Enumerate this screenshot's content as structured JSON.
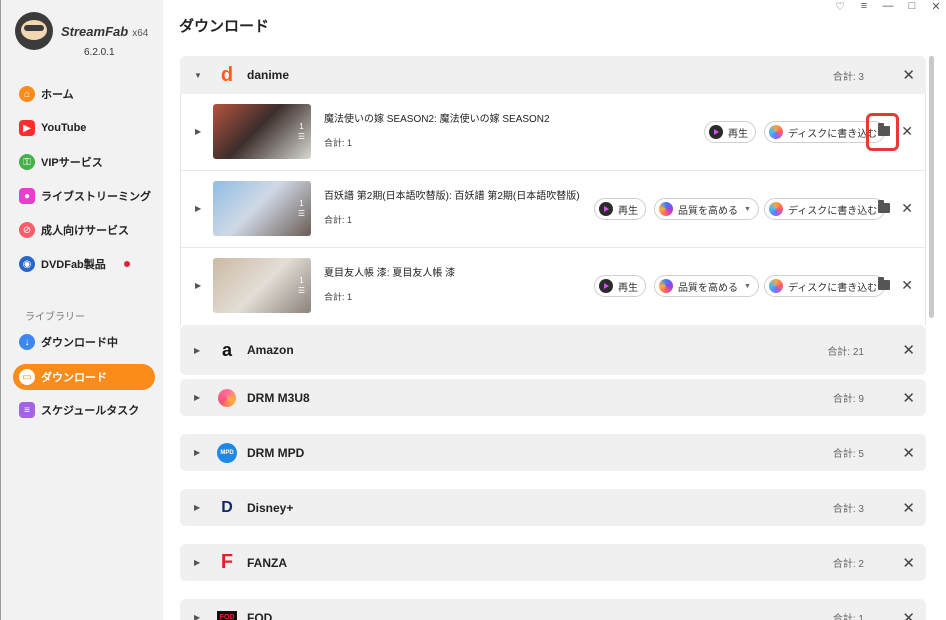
{
  "app": {
    "brand": "StreamFab",
    "brand_suffix": "x64",
    "version": "6.2.0.1"
  },
  "window_controls": [
    "♡",
    "≡",
    "—",
    "□",
    "✕"
  ],
  "sidebar": {
    "items": [
      {
        "label": "ホーム",
        "icon": "home-icon",
        "color": "#fb8c1a"
      },
      {
        "label": "YouTube",
        "icon": "youtube-icon",
        "color": "#ff2d2d"
      },
      {
        "label": "VIPサービス",
        "icon": "key-icon",
        "color": "#46b04a"
      },
      {
        "label": "ライブストリーミング",
        "icon": "live-camera-icon",
        "color": "#e83ed0"
      },
      {
        "label": "成人向けサービス",
        "icon": "adult-18-icon",
        "color": "#ff5b6a"
      },
      {
        "label": "DVDFab製品",
        "icon": "dvdfab-icon",
        "color": "#2a66c9"
      }
    ],
    "library_label": "ライブラリー",
    "library_items": [
      {
        "label": "ダウンロード中",
        "icon": "download-arrow-icon",
        "color": "#3d88f0"
      },
      {
        "label": "ダウンロード",
        "icon": "folder-icon",
        "color": "#fb8c1a"
      },
      {
        "label": "スケジュールタスク",
        "icon": "schedule-list-icon",
        "color": "#a463e0"
      }
    ]
  },
  "page_title": "ダウンロード",
  "groups": [
    {
      "name": "danime",
      "count": "合計: 3",
      "icon": "danime-icon",
      "items": [
        {
          "title": "魔法使いの嫁 SEASON2: 魔法使いの嫁 SEASON2",
          "count": "合計: 1",
          "tag": "1"
        },
        {
          "title": "百妖譜 第2期(日本語吹替版): 百妖譜 第2期(日本語吹替版)",
          "count": "合計: 1",
          "tag": "1"
        },
        {
          "title": "夏目友人帳 漆: 夏目友人帳 漆",
          "count": "合計: 1",
          "tag": "1"
        }
      ]
    },
    {
      "name": "Amazon",
      "count": "合計: 21",
      "icon": "amazon-icon"
    },
    {
      "name": "DRM M3U8",
      "count": "合計: 9",
      "icon": "drm-m3u8-icon"
    },
    {
      "name": "DRM MPD",
      "count": "合計: 5",
      "icon": "drm-mpd-icon"
    },
    {
      "name": "Disney+",
      "count": "合計: 3",
      "icon": "disney-plus-icon"
    },
    {
      "name": "FANZA",
      "count": "合計: 2",
      "icon": "fanza-icon"
    },
    {
      "name": "FOD",
      "count": "合計: 1",
      "icon": "fod-icon"
    }
  ],
  "actions": {
    "play": "再生",
    "quality": "品質を高める",
    "burn": "ディスクに書き込む"
  }
}
